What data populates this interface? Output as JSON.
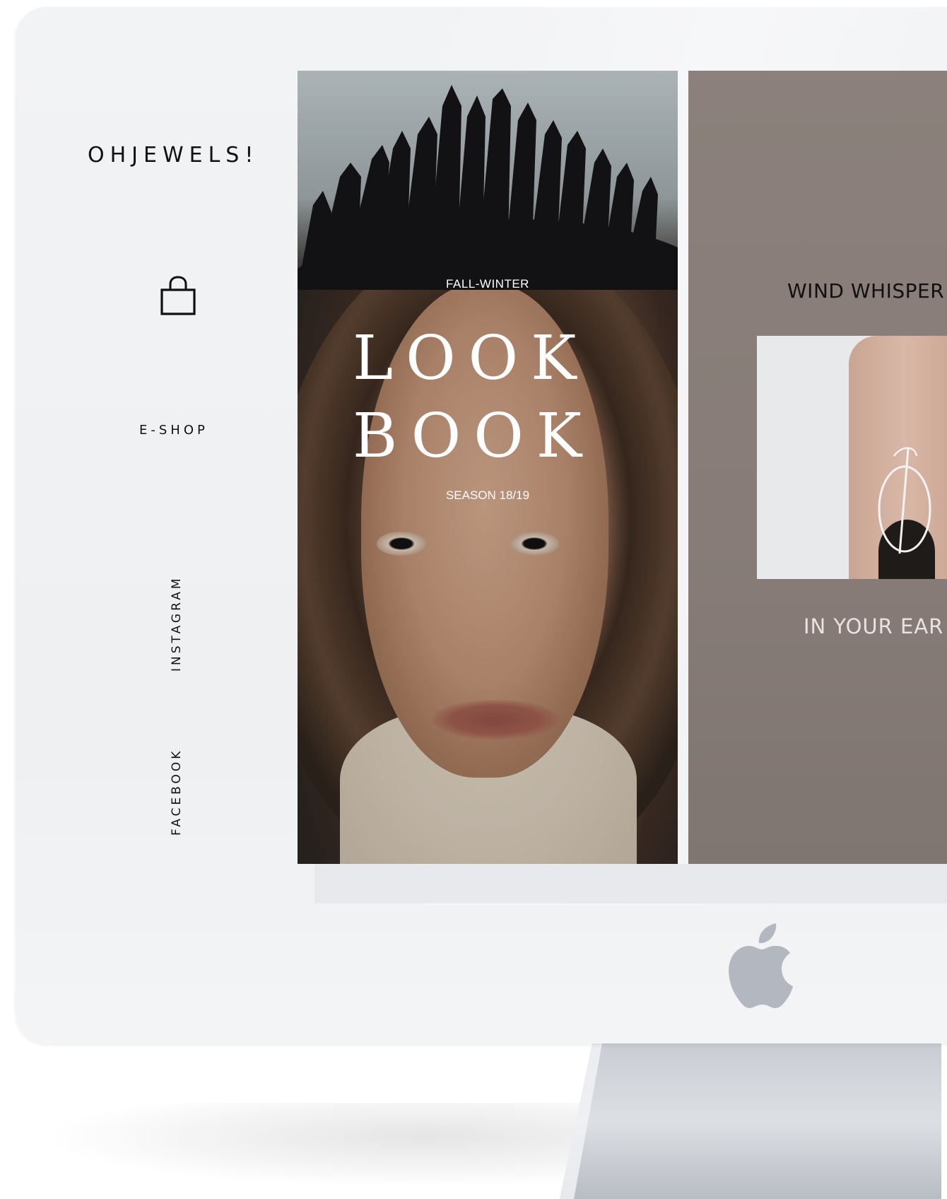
{
  "brand": "OHJEWELS!",
  "nav": {
    "bag_icon": "shopping-bag-icon",
    "eshop": "E-SHOP",
    "instagram": "INSTAGRAM",
    "facebook": "FACEBOOK"
  },
  "lookbook": {
    "kicker": "FALL-WINTER",
    "title_line1": "LOOK",
    "title_line2": "BOOK",
    "season": "SEASON 18/19"
  },
  "feature": {
    "title": "WIND WHISPER",
    "subtitle": "IN YOUR EAR",
    "panel_color": "#887d78"
  },
  "device": {
    "logo_icon": "apple-logo-icon"
  }
}
